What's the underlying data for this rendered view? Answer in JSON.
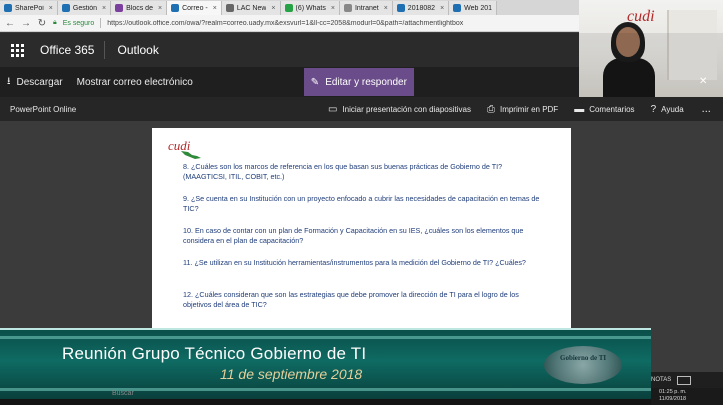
{
  "browser": {
    "tabs": [
      {
        "label": "SharePoi",
        "color": "#1f6fb3",
        "active": false
      },
      {
        "label": "Gestión",
        "color": "#1f6fb3",
        "active": false
      },
      {
        "label": "Blocs de",
        "color": "#7b3fa0",
        "active": false
      },
      {
        "label": "Correo -",
        "color": "#1f6fb3",
        "active": true
      },
      {
        "label": "LAC New",
        "color": "#666666",
        "active": false
      },
      {
        "label": "(6) Whats",
        "color": "#25a244",
        "active": false
      },
      {
        "label": "Intranet",
        "color": "#888888",
        "active": false
      },
      {
        "label": "2018082",
        "color": "#1f6fb3",
        "active": false
      },
      {
        "label": "Web 201",
        "color": "#1f6fb3",
        "active": false
      }
    ],
    "secure_label": "Es seguro",
    "url": "https://outlook.office.com/owa/?realm=correo.uady.mx&exsvurl=1&ll-cc=2058&modurl=0&path=/attachmentlightbox"
  },
  "office": {
    "app_suite": "Office 365",
    "app_name": "Outlook"
  },
  "command_bar": {
    "download_label": "Descargar",
    "show_email_label": "Mostrar correo electrónico",
    "edit_reply_label": "Editar y responder"
  },
  "ppt_bar": {
    "title": "PowerPoint Online",
    "slideshow_label": "Iniciar presentación con diapositivas",
    "print_label": "Imprimir en PDF",
    "comments_label": "Comentarios",
    "help_label": "Ayuda",
    "more_label": "..."
  },
  "slide": {
    "logo_text": "cudi",
    "questions": [
      "8. ¿Cuáles son los marcos de referencia en los que basan sus buenas prácticas de Gobierno de TI? (MAAGTICSI, ITIL, COBIT, etc.)",
      "9. ¿Se cuenta en su Institución con un proyecto enfocado a cubrir las necesidades de capacitación en temas de TIC?",
      "10. En caso de contar con un plan de Formación y Capacitación en su IES, ¿cuáles son los elementos que considera en el plan de capacitación?",
      "11. ¿Se utilizan en su Institución herramientas/instrumentos para la medición del Gobierno de TI? ¿Cuáles?",
      "12. ¿Cuáles consideran que son las estrategias que debe promover la dirección de TI para el logro de los objetivos del área de TIC?"
    ]
  },
  "banner": {
    "title": "Reunión Grupo Técnico Gobierno de TI",
    "date": "11 de septiembre 2018",
    "seal_text": "Gobierno de TI"
  },
  "taskbar": {
    "search_label": "Buscar",
    "notes_label": "NOTAS",
    "time": "01:25 p. m.",
    "date": "11/09/2018"
  },
  "webcam": {
    "logo_text": "cudi"
  },
  "colors": {
    "office_header": "#2b2b2b",
    "edit_button": "#6b4c8a",
    "slide_text": "#1f3d7a",
    "banner": "#0e6b63"
  }
}
